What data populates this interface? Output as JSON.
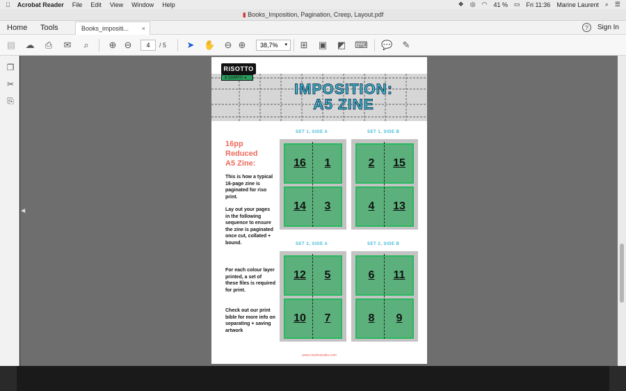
{
  "menubar": {
    "app_name": "Acrobat Reader",
    "items": [
      "File",
      "Edit",
      "View",
      "Window",
      "Help"
    ],
    "battery": "41 %",
    "time": "Fri 11:36",
    "user": "Marine Laurent"
  },
  "window": {
    "title": "Books_Imposition, Pagination, Creep, Layout.pdf"
  },
  "tabs": {
    "home": "Home",
    "tools": "Tools",
    "doc": "Books_impositi...",
    "close": "×"
  },
  "account": {
    "help": "?",
    "signin": "Sign In"
  },
  "toolbar": {
    "page_current": "4",
    "page_total": "/ 5",
    "zoom": "38,7%",
    "zoom_caret": "▾"
  },
  "document": {
    "logo_text": "RiSOTTO",
    "logo_sub": "& QUARTO ➜",
    "title_line1": "IMPOSITION:",
    "title_line2": "A5 ZINE",
    "heading": "16pp Reduced A5 Zine:",
    "para1": "This is how a typical 16-page zine is paginated for riso print.",
    "para2": "Lay out your pages in the following sequence to ensure the zine is paginated once cut, collated + bound.",
    "para3": "For each colour layer printed, a set of these files is required for print.",
    "para4": "Check out our print bible for more info on separating + saving artwork",
    "footer": "www.risottostudio.com",
    "sets": [
      {
        "label": "SET 1,  SIDE A",
        "pages": [
          "16",
          "1",
          "14",
          "3"
        ]
      },
      {
        "label": "SET 1,  SIDE B",
        "pages": [
          "2",
          "15",
          "4",
          "13"
        ]
      },
      {
        "label": "SET 2,  SIDE A",
        "pages": [
          "12",
          "5",
          "10",
          "7"
        ]
      },
      {
        "label": "SET 2,  SIDE B",
        "pages": [
          "6",
          "11",
          "8",
          "9"
        ]
      }
    ]
  },
  "colors": {
    "accent_blue": "#3dbad6",
    "coral": "#ee6a5d",
    "green": "#5bb07c",
    "green_border": "#28b85e"
  },
  "icons": [
    "apple-icon",
    "save-icon",
    "upload-icon",
    "print-icon",
    "email-icon",
    "search-icon",
    "prev-page-icon",
    "next-page-icon",
    "select-arrow-icon",
    "hand-icon",
    "zoom-out-icon",
    "zoom-in-icon",
    "fit-page-icon",
    "scroll-mode-icon",
    "read-mode-icon",
    "keyboard-icon",
    "comment-icon",
    "highlight-icon"
  ]
}
